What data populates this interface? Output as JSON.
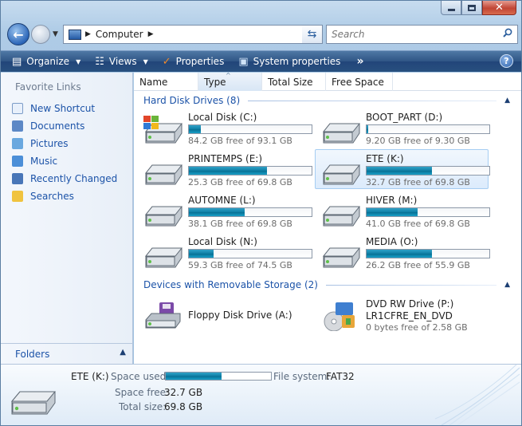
{
  "window": {
    "title_buttons": {
      "minimize": "minimize",
      "maximize": "maximize",
      "close": "✕"
    }
  },
  "address": {
    "crumb": "Computer"
  },
  "search": {
    "placeholder": "Search"
  },
  "commands": [
    {
      "label": "Organize",
      "icon": "organize-icon",
      "has_menu": true
    },
    {
      "label": "Views",
      "icon": "views-icon",
      "has_menu": true
    },
    {
      "label": "Properties",
      "icon": "properties-icon",
      "has_menu": false
    },
    {
      "label": "System properties",
      "icon": "system-properties-icon",
      "has_menu": false
    }
  ],
  "nav": {
    "heading": "Favorite Links",
    "links": [
      {
        "label": "New Shortcut",
        "icon": "shortcut-icon",
        "color": "#e8f0fb"
      },
      {
        "label": "Documents",
        "icon": "documents-icon",
        "color": "#5c88c6"
      },
      {
        "label": "Pictures",
        "icon": "pictures-icon",
        "color": "#6aa8df"
      },
      {
        "label": "Music",
        "icon": "music-icon",
        "color": "#4c8fd8"
      },
      {
        "label": "Recently Changed",
        "icon": "recent-icon",
        "color": "#4876b8"
      },
      {
        "label": "Searches",
        "icon": "searches-icon",
        "color": "#f0c33f"
      }
    ],
    "folders_label": "Folders"
  },
  "columns": [
    "Name",
    "Type",
    "Total Size",
    "Free Space"
  ],
  "groups": {
    "hard_disks": "Hard Disk Drives (8)",
    "removable": "Devices with Removable Storage (2)"
  },
  "drives": [
    {
      "name": "Local Disk (C:)",
      "free": "84.2 GB free of 93.1 GB",
      "used_fraction": 0.096,
      "icon": "windows-drive-icon"
    },
    {
      "name": "BOOT_PART (D:)",
      "free": "9.20 GB free of 9.30 GB",
      "used_fraction": 0.011,
      "icon": "hard-drive-icon"
    },
    {
      "name": "PRINTEMPS (E:)",
      "free": "25.3 GB free of 69.8 GB",
      "used_fraction": 0.638,
      "icon": "hard-drive-icon"
    },
    {
      "name": "ETE (K:)",
      "free": "32.7 GB free of 69.8 GB",
      "used_fraction": 0.532,
      "icon": "hard-drive-icon",
      "selected": true
    },
    {
      "name": "AUTOMNE (L:)",
      "free": "38.1 GB free of 69.8 GB",
      "used_fraction": 0.454,
      "icon": "hard-drive-icon"
    },
    {
      "name": "HIVER (M:)",
      "free": "41.0 GB free of 69.8 GB",
      "used_fraction": 0.413,
      "icon": "hard-drive-icon"
    },
    {
      "name": "Local Disk (N:)",
      "free": "59.3 GB free of 74.5 GB",
      "used_fraction": 0.204,
      "icon": "hard-drive-icon"
    },
    {
      "name": "MEDIA (O:)",
      "free": "26.2 GB free of 55.9 GB",
      "used_fraction": 0.531,
      "icon": "hard-drive-icon"
    }
  ],
  "removable": [
    {
      "name": "Floppy Disk Drive (A:)",
      "icon": "floppy-drive-icon"
    },
    {
      "name": "DVD RW Drive (P:)",
      "label": "LR1CFRE_EN_DVD",
      "free": "0 bytes free of 2.58 GB",
      "icon": "dvd-drive-icon"
    }
  ],
  "details": {
    "name": "ETE (K:)",
    "space_used_label": "Space used:",
    "space_used_fraction": 0.532,
    "filesystem_label": "File system:",
    "filesystem": "FAT32",
    "space_free_label": "Space free:",
    "space_free": "32.7 GB",
    "total_size_label": "Total size:",
    "total_size": "69.8 GB"
  },
  "colors": {
    "accent": "#1c53a8",
    "bar_fill": "#0f7ea4",
    "command_bar": "#2f5585"
  }
}
